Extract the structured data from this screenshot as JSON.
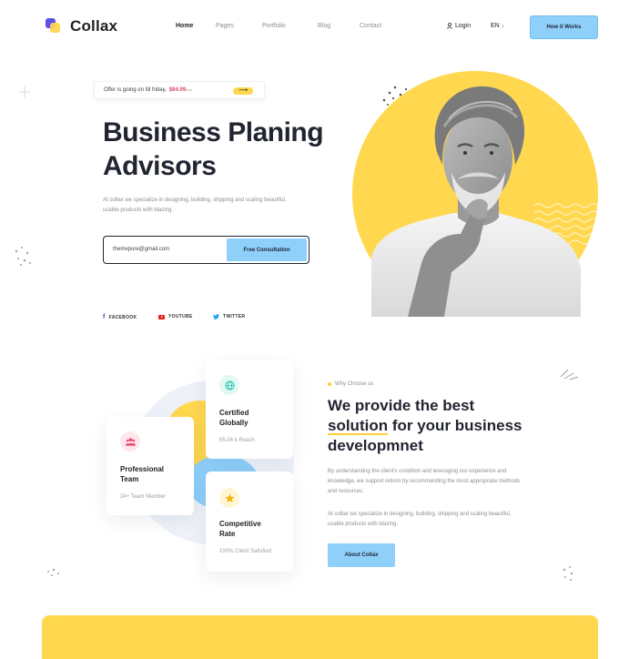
{
  "brand": {
    "name": "Collax"
  },
  "nav": {
    "items": [
      {
        "label": "Home",
        "active": true
      },
      {
        "label": "Pages",
        "active": false
      },
      {
        "label": "Portfolio",
        "active": false
      },
      {
        "label": "Blog",
        "active": false
      },
      {
        "label": "Contact",
        "active": false
      }
    ],
    "login_label": "Login",
    "lang_label": "EN",
    "cta_label": "How it Works"
  },
  "hero": {
    "offer_text": "Offer is going on till friday,",
    "offer_price": "$84.99",
    "offer_price_suffix": "/mo",
    "title_line1": "Business Planing",
    "title_line2": "Advisors",
    "subtitle": "At collax we specialize in designing, building, shipping and scaling beautiful, usable products with blazing.",
    "email_value": "themepure@gmail.com",
    "consult_button": "Free Consultation",
    "socials": [
      {
        "label": "FACEBOOK",
        "icon": "facebook-icon"
      },
      {
        "label": "YOUTUBE",
        "icon": "youtube-icon"
      },
      {
        "label": "TWITTER",
        "icon": "twitter-icon"
      }
    ]
  },
  "features": {
    "cards": [
      {
        "title_l1": "Certified",
        "title_l2": "Globally",
        "stat": "65.04 k Reach",
        "icon": "globe-icon",
        "icon_color": "#1fbfa6",
        "icon_bg": "#e3f8f4"
      },
      {
        "title_l1": "Professional",
        "title_l2": "Team",
        "stat": "24+ Team Member",
        "icon": "team-icon",
        "icon_color": "#e8496c",
        "icon_bg": "#fde6ec"
      },
      {
        "title_l1": "Competitive",
        "title_l2": "Rate",
        "stat": "100% Client Satisfied",
        "icon": "star-icon",
        "icon_color": "#f2b40c",
        "icon_bg": "#fff6d6"
      }
    ],
    "tag": "Why Choose us",
    "title_l1": "We provide the best",
    "title_hl": "solution",
    "title_l2_rest": " for your business",
    "title_l3": "developmnet",
    "para1": "By understanding the client's condition and leveraging our experience and knowledge, we support reform by recommending the most appropriate methods and resources.",
    "para2": "At collax we specialize in designing, building, shipping and scaling beautiful, usable products with blazing.",
    "button": "About Collax"
  },
  "colors": {
    "accent_yellow": "#ffd84f",
    "accent_blue": "#8fd0fb",
    "price_pink": "#e8496c"
  }
}
